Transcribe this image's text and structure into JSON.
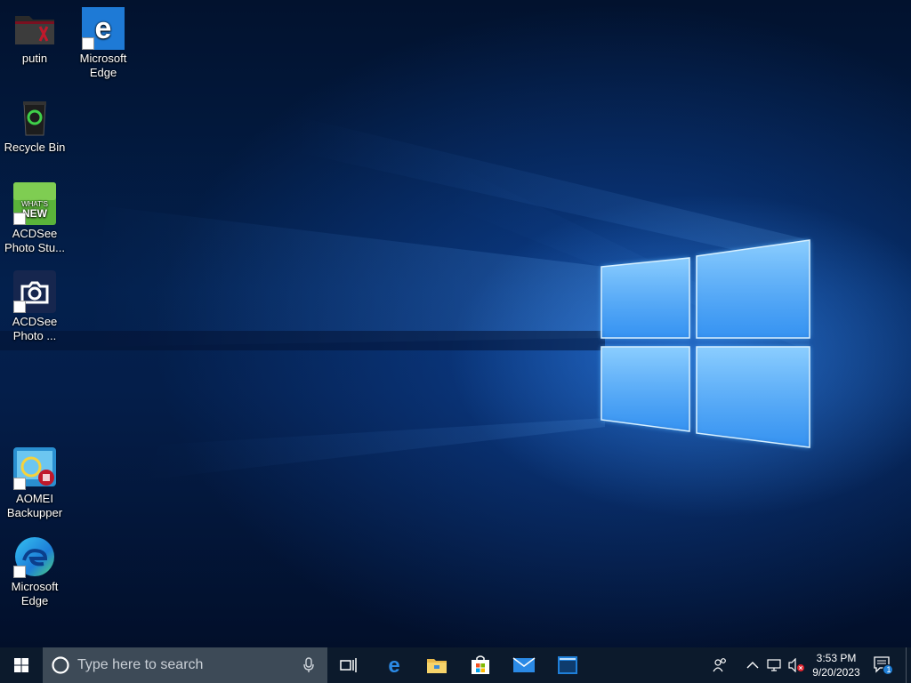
{
  "desktop": {
    "icons": [
      {
        "label": "putin",
        "icon": "folder-icon"
      },
      {
        "label": "Microsoft Edge",
        "icon": "edge-legacy-icon"
      },
      {
        "label": "Recycle Bin",
        "icon": "recycle-bin-icon"
      },
      {
        "label": "ACDSee Photo Stu...",
        "icon": "acdsee-whats-new-icon",
        "badge": "WHAT'S NEW"
      },
      {
        "label": "ACDSee Photo ...",
        "icon": "acdsee-camera-icon"
      },
      {
        "label": "AOMEI Backupper",
        "icon": "aomei-backupper-icon"
      },
      {
        "label": "Microsoft Edge",
        "icon": "edge-chromium-icon"
      }
    ]
  },
  "taskbar": {
    "search_placeholder": "Type here to search",
    "pinned": [
      "task-view-icon",
      "edge-icon",
      "file-explorer-icon",
      "microsoft-store-icon",
      "mail-icon",
      "window-app-icon"
    ],
    "tray": [
      "people-icon",
      "chevron-up-icon",
      "network-icon",
      "volume-muted-icon"
    ],
    "clock": {
      "time": "3:53 PM",
      "date": "9/20/2023"
    },
    "notifications": {
      "count": "1"
    }
  },
  "colors": {
    "accent": "#0078d7",
    "taskbar": "#0c1a2c",
    "search_box": "#3d4a57"
  }
}
